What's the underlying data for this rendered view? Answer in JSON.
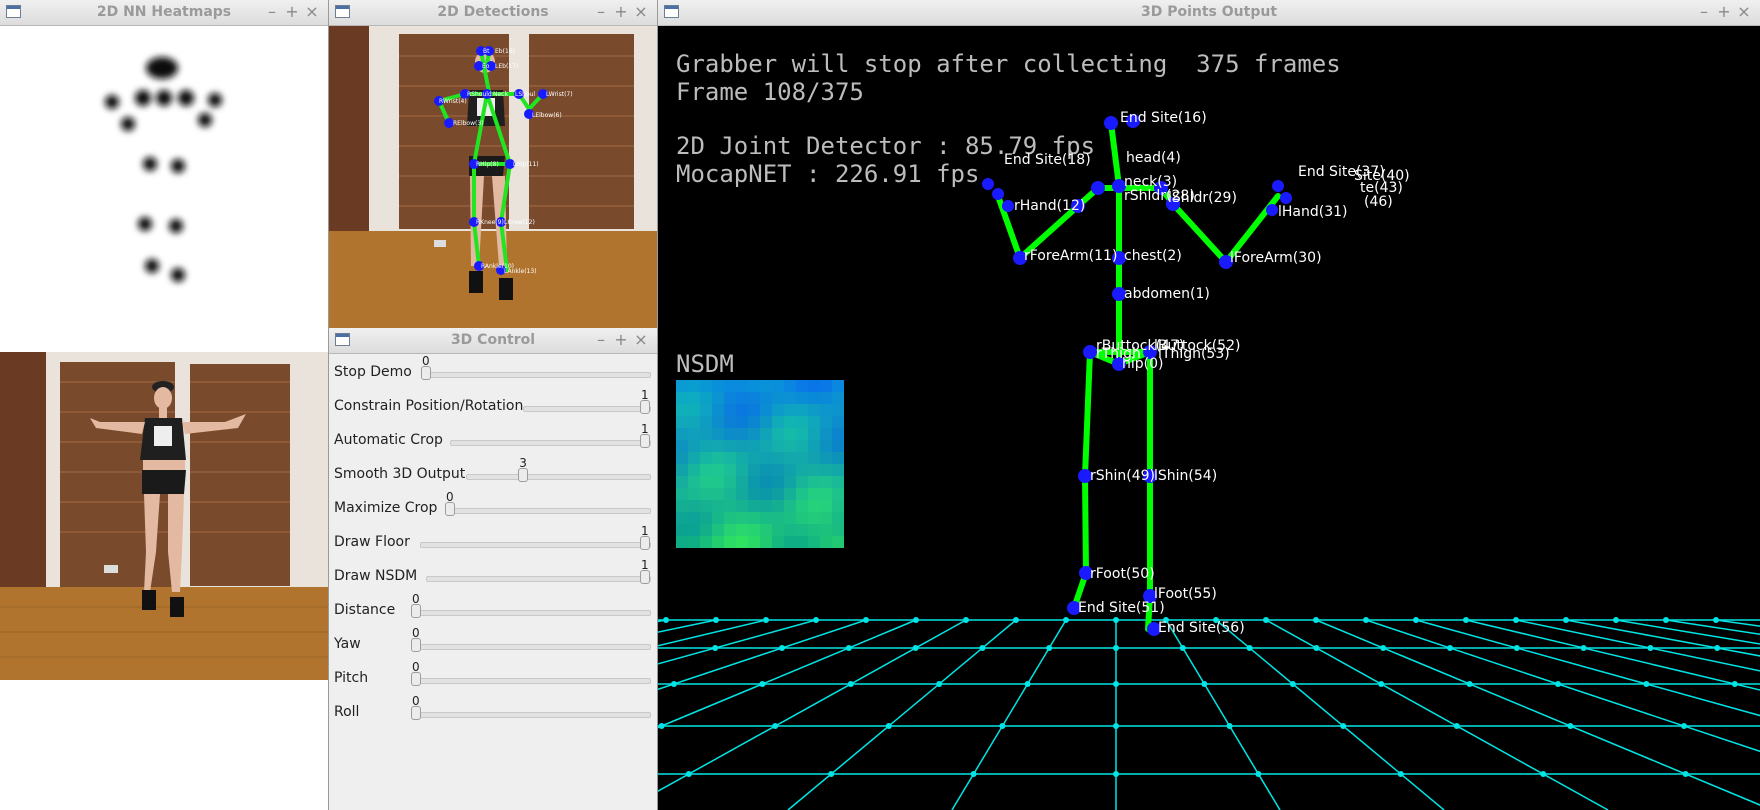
{
  "windows": {
    "heatmaps": {
      "title": "2D NN Heatmaps"
    },
    "detections": {
      "title": "2D Detections"
    },
    "control": {
      "title": "3D Control"
    },
    "points": {
      "title": "3D Points Output"
    }
  },
  "window_buttons": {
    "minimize": "–",
    "maximize": "+",
    "close": "×"
  },
  "control": {
    "sliders": [
      {
        "label": "Stop Demo",
        "value": "0",
        "fraction": 0.0
      },
      {
        "label": "Constrain Position/Rotation",
        "value": "1",
        "fraction": 1.0
      },
      {
        "label": "Automatic Crop",
        "value": "1",
        "fraction": 1.0
      },
      {
        "label": "Smooth 3D Output",
        "value": "3",
        "fraction": 0.3
      },
      {
        "label": "Maximize Crop",
        "value": "0",
        "fraction": 0.0
      },
      {
        "label": "Draw Floor",
        "value": "1",
        "fraction": 1.0
      },
      {
        "label": "Draw NSDM",
        "value": "1",
        "fraction": 1.0
      },
      {
        "label": "Distance",
        "value": "0",
        "fraction": 0.0
      },
      {
        "label": "Yaw",
        "value": "0",
        "fraction": 0.0
      },
      {
        "label": "Pitch",
        "value": "0",
        "fraction": 0.0
      },
      {
        "label": "Roll",
        "value": "0",
        "fraction": 0.0
      }
    ]
  },
  "overlay": {
    "grabber": "Grabber will stop after collecting  375 frames",
    "frame": "Frame 108/375",
    "detector_fps": "2D Joint Detector : 85.79 fps",
    "mocapnet_fps": "MocapNET : 226.91 fps",
    "nsdm_label": "NSDM"
  },
  "detections_labels": [
    "Bt",
    "Eb(16)",
    "Eo",
    "LEb(17)",
    "RShould",
    "Neck",
    "LShoul",
    "LWrist(7)",
    "RWrist(4)",
    "RElbow(3)",
    "LElbow(6)",
    "RHip(8)",
    "LHip(11)",
    "RKnee(9)",
    "LKnee(12)",
    "RAnkle(10)",
    "LAnkle(13)"
  ],
  "joint_labels": [
    "End Site(16)",
    "head(4)",
    "neck(3)",
    "rShldr(28)",
    "lShldr(29)",
    "rForeArm(11)",
    "chest(2)",
    "lForeArm(30)",
    "abdomen(1)",
    "rButtock(47)",
    "lButtock(52)",
    "rThigh",
    "lThigh(53)",
    "hip(0)",
    "rShin(49)",
    "lShin(54)",
    "rFoot(50)",
    "lFoot(55)",
    "End Site(51)",
    "End Site(56)",
    "End Site(37)",
    "rHand(12)",
    "lHand(31)",
    "End Site(18)",
    "Site(40)",
    "te(43)",
    "(46)"
  ],
  "colors": {
    "skeleton": "#00ff00",
    "joint": "#1a1aff",
    "floor": "#00e5e5",
    "overlay_text": "#bcbcbc"
  },
  "icons": {
    "window": "window-icon"
  }
}
